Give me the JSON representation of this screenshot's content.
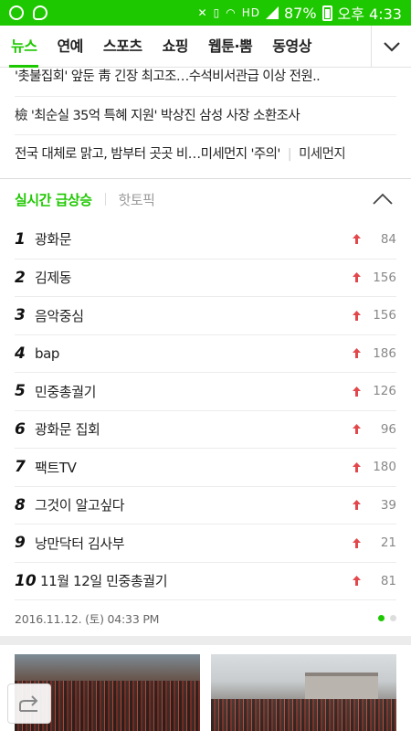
{
  "status_bar": {
    "battery_percent": "87%",
    "time": "오후 4:33",
    "icons": [
      "notification-icon",
      "g-app-icon",
      "mute-icon",
      "vibrate-icon",
      "wifi-icon",
      "hd-icon",
      "signal-icon",
      "battery-icon"
    ]
  },
  "nav": {
    "tabs": [
      {
        "label": "뉴스",
        "active": true
      },
      {
        "label": "연예",
        "active": false
      },
      {
        "label": "스포츠",
        "active": false
      },
      {
        "label": "쇼핑",
        "active": false
      },
      {
        "label": "웹툰·뿜",
        "active": false
      },
      {
        "label": "동영상",
        "active": false
      }
    ],
    "toggle_icon": "chevron-down-icon"
  },
  "news": {
    "items": [
      {
        "text": "'촛불집회' 앞둔 靑 긴장 최고조…수석비서관급 이상 전원.."
      },
      {
        "text": "檢 '최순실 35억 특혜 지원' 박상진 삼성 사장 소환조사"
      },
      {
        "text": "전국 대체로 맑고, 밤부터 곳곳 비…미세먼지 '주의'",
        "keyword": "미세먼지"
      }
    ]
  },
  "realtime": {
    "tab_active": "실시간 급상승",
    "tab_inactive": "핫토픽",
    "collapse_icon": "chevron-up-icon",
    "rankings": [
      {
        "rank": "1",
        "term": "광화문",
        "count": "84"
      },
      {
        "rank": "2",
        "term": "김제동",
        "count": "156"
      },
      {
        "rank": "3",
        "term": "음악중심",
        "count": "156"
      },
      {
        "rank": "4",
        "term": "bap",
        "count": "186"
      },
      {
        "rank": "5",
        "term": "민중총궐기",
        "count": "126"
      },
      {
        "rank": "6",
        "term": "광화문 집회",
        "count": "96"
      },
      {
        "rank": "7",
        "term": "팩트TV",
        "count": "180"
      },
      {
        "rank": "8",
        "term": "그것이 알고싶다",
        "count": "39"
      },
      {
        "rank": "9",
        "term": "낭만닥터 김사부",
        "count": "21"
      },
      {
        "rank": "10",
        "term": "11월 12일 민중총궐기",
        "count": "81"
      }
    ],
    "timestamp": "2016.11.12. (토) 04:33 PM",
    "page_dots": 2,
    "active_dot": 0
  },
  "colors": {
    "brand_green": "#1ec800",
    "up_arrow": "#e2474b"
  }
}
